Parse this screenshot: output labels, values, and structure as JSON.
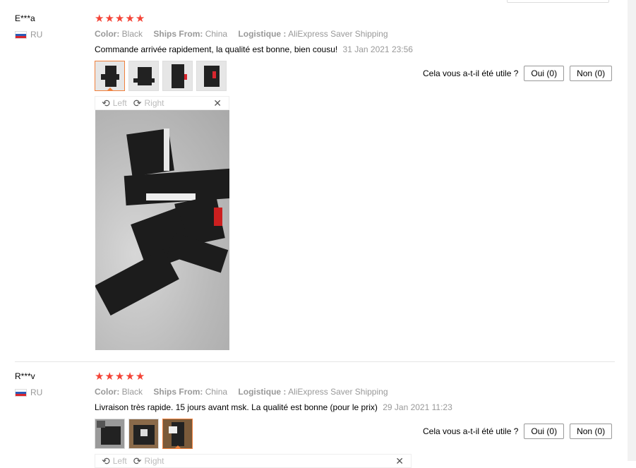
{
  "reviews": [
    {
      "user": "E***a",
      "country": "RU",
      "rating": 5,
      "color_label": "Color:",
      "color_value": "Black",
      "ships_label": "Ships From:",
      "ships_value": "China",
      "logistics_label": "Logistique :",
      "logistics_value": "AliExpress Saver Shipping",
      "comment": "Commande arrivée rapidement, la qualité est bonne, bien cousu!",
      "date": "31 Jan 2021 23:56",
      "helpful_question": "Cela vous a-t-il été utile ?",
      "yes_label": "Oui (0)",
      "no_label": "Non (0)",
      "rotate_left": "Left",
      "rotate_right": "Right"
    },
    {
      "user": "R***v",
      "country": "RU",
      "rating": 5,
      "color_label": "Color:",
      "color_value": "Black",
      "ships_label": "Ships From:",
      "ships_value": "China",
      "logistics_label": "Logistique :",
      "logistics_value": "AliExpress Saver Shipping",
      "comment": "Livraison très rapide. 15 jours avant msk. La qualité est bonne (pour le prix)",
      "date": "29 Jan 2021 11:23",
      "helpful_question": "Cela vous a-t-il été utile ?",
      "yes_label": "Oui (0)",
      "no_label": "Non (0)",
      "rotate_left": "Left",
      "rotate_right": "Right"
    }
  ],
  "icons": {
    "star": "★",
    "rotate_left": "⟲",
    "rotate_right": "⟳",
    "close": "✕"
  },
  "colors": {
    "star": "#f44336",
    "active_thumb": "#f0803c"
  }
}
